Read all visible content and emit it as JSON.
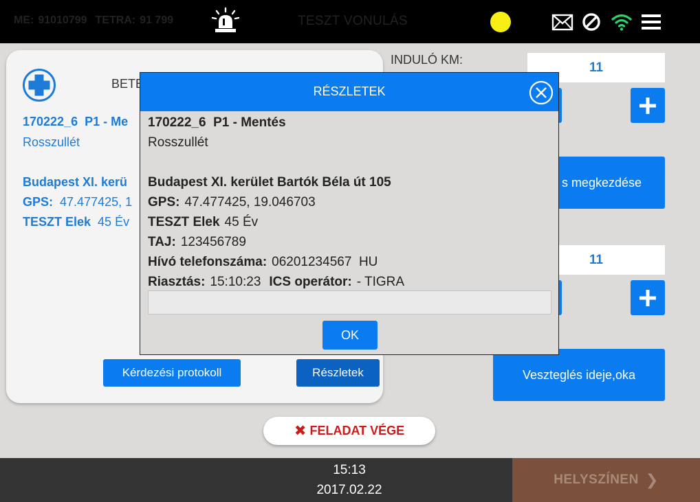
{
  "topbar": {
    "me_label": "ME:",
    "me_value": "91010799",
    "tetra_label": "TETRA:",
    "tetra_value": "91 799",
    "title": "TESZT VONULÁS",
    "status_color": "#f6ee14",
    "icons": [
      "siren-icon",
      "mail-icon",
      "block-icon",
      "wifi-icon",
      "menu-icon"
    ]
  },
  "card": {
    "title": "BETE",
    "line1_id": "170222_6",
    "line1_type": "P1 - Me",
    "line2": "Rosszullét",
    "address": "Budapest XI. kerü",
    "gps_label": "GPS:",
    "gps_value": "47.477425, 1",
    "patient_name": "TESZT Elek",
    "patient_age": "45 Év",
    "protocol_button": "Kérdezési protokoll",
    "details_button": "Részletek"
  },
  "right": {
    "start_km_label": "INDULÓ KM:",
    "start_km_value": "11",
    "start_button": "s megkezdése",
    "second_km_value": "11",
    "delay_button": "Veszteglés ideje,oka"
  },
  "end_task": {
    "label": "FELADAT VÉGE"
  },
  "bottombar": {
    "time": "15:13",
    "date": "2017.02.22",
    "location_button": "HELYSZÍNEN"
  },
  "dialog": {
    "title": "RÉSZLETEK",
    "case_id": "170222_6",
    "case_type": "P1 - Mentés",
    "complaint": "Rosszullét",
    "address": "Budapest XI. kerület Bartók Béla út 105",
    "gps_label": "GPS:",
    "gps_value": "47.477425, 19.046703",
    "patient_name": "TESZT Elek",
    "patient_age": "45 Év",
    "taj_label": "TAJ:",
    "taj_value": "123456789",
    "caller_label": "Hívó telefonszáma:",
    "caller_value": "06201234567  HU",
    "alarm_label": "Riasztás:",
    "alarm_value": "15:10:23",
    "operator_label": "ICS operátor:",
    "operator_value": "- TIGRA",
    "note_value": "",
    "ok_button": "OK"
  }
}
